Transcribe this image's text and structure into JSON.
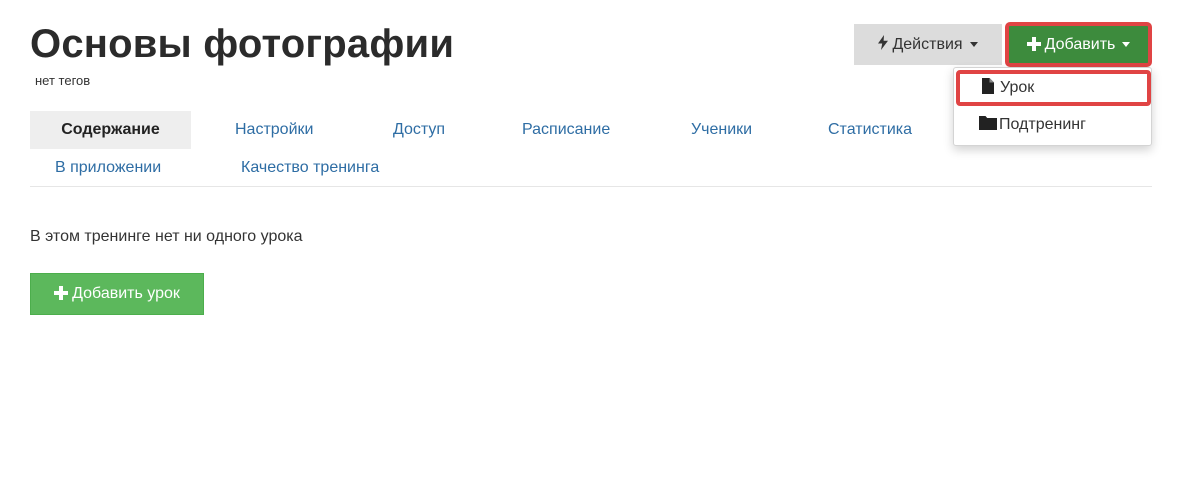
{
  "header": {
    "title": "Основы фотографии",
    "tags": "нет тегов"
  },
  "toolbar": {
    "actions_label": "Действия",
    "actions_icon": "bolt-icon",
    "add_label": "Добавить",
    "add_icon": "plus-icon"
  },
  "dropdown": {
    "items": [
      {
        "label": "Урок",
        "icon": "file-icon"
      },
      {
        "label": "Подтренинг",
        "icon": "folder-icon"
      }
    ]
  },
  "tabs": [
    {
      "label": "Содержание",
      "active": true
    },
    {
      "label": "Настройки"
    },
    {
      "label": "Доступ"
    },
    {
      "label": "Расписание"
    },
    {
      "label": "Ученики"
    },
    {
      "label": "Статистика"
    },
    {
      "label": "В приложении"
    },
    {
      "label": "Качество тренинга"
    }
  ],
  "main": {
    "empty_message": "В этом тренинге нет ни одного урока",
    "add_lesson_label": "Добавить урок",
    "add_lesson_icon": "plus-icon"
  },
  "colors": {
    "primary_green": "#3d8b3d",
    "success_green": "#5cb85c",
    "highlight_red": "#e04444",
    "link_blue": "#2e6da4"
  }
}
